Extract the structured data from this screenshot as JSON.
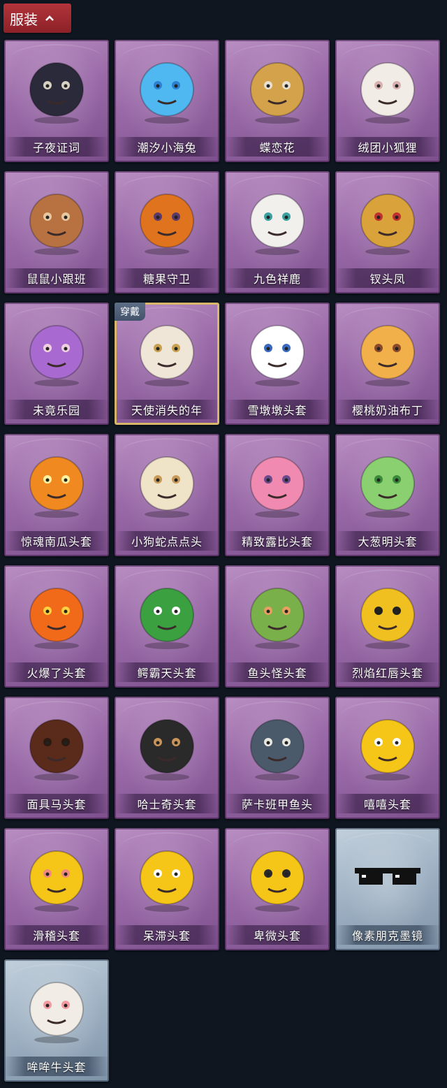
{
  "category": {
    "label": "服装"
  },
  "equipped_badge": "穿戴",
  "items": [
    {
      "name": "子夜证词",
      "icon": "owl-costume-icon",
      "tint": "purple"
    },
    {
      "name": "潮汐小海兔",
      "icon": "blue-sea-bunny-icon",
      "tint": "purple"
    },
    {
      "name": "蝶恋花",
      "icon": "bell-wreath-icon",
      "tint": "purple"
    },
    {
      "name": "绒团小狐狸",
      "icon": "white-fox-icon",
      "tint": "purple"
    },
    {
      "name": "鼠鼠小跟班",
      "icon": "hamster-icon",
      "tint": "purple"
    },
    {
      "name": "糖果守卫",
      "icon": "pumpkin-scarecrow-icon",
      "tint": "purple"
    },
    {
      "name": "九色祥鹿",
      "icon": "deer-icon",
      "tint": "purple"
    },
    {
      "name": "钗头凤",
      "icon": "phoenix-crown-doll-icon",
      "tint": "purple"
    },
    {
      "name": "未竟乐园",
      "icon": "purple-hair-doll-icon",
      "tint": "purple"
    },
    {
      "name": "天使消失的年",
      "icon": "angel-doll-icon",
      "tint": "purple",
      "equipped": true
    },
    {
      "name": "雪墩墩头套",
      "icon": "snowman-head-icon",
      "tint": "purple"
    },
    {
      "name": "樱桃奶油布丁",
      "icon": "pudding-head-icon",
      "tint": "purple"
    },
    {
      "name": "惊魂南瓜头套",
      "icon": "pumpkin-head-icon",
      "tint": "purple"
    },
    {
      "name": "小狗蛇点点头",
      "icon": "snake-head-icon",
      "tint": "purple"
    },
    {
      "name": "精致露比头套",
      "icon": "pink-beaver-head-icon",
      "tint": "purple"
    },
    {
      "name": "大葱明头套",
      "icon": "scallion-head-icon",
      "tint": "purple"
    },
    {
      "name": "火爆了头套",
      "icon": "fire-head-icon",
      "tint": "purple"
    },
    {
      "name": "鳄霸天头套",
      "icon": "crocodile-head-icon",
      "tint": "purple"
    },
    {
      "name": "鱼头怪头套",
      "icon": "fish-head-icon",
      "tint": "purple"
    },
    {
      "name": "烈焰红唇头套",
      "icon": "yellow-mask-head-icon",
      "tint": "purple"
    },
    {
      "name": "面具马头套",
      "icon": "horse-head-icon",
      "tint": "purple"
    },
    {
      "name": "哈士奇头套",
      "icon": "dog-head-icon",
      "tint": "purple"
    },
    {
      "name": "萨卡班甲鱼头",
      "icon": "fish-blob-head-icon",
      "tint": "purple"
    },
    {
      "name": "嘻嘻头套",
      "icon": "grin-emoji-head-icon",
      "tint": "purple"
    },
    {
      "name": "滑稽头套",
      "icon": "smirk-emoji-head-icon",
      "tint": "purple"
    },
    {
      "name": "呆滞头套",
      "icon": "stare-emoji-head-icon",
      "tint": "purple"
    },
    {
      "name": "卑微头套",
      "icon": "shy-emoji-head-icon",
      "tint": "purple"
    },
    {
      "name": "像素朋克墨镜",
      "icon": "pixel-sunglasses-icon",
      "tint": "blue"
    },
    {
      "name": "哞哞牛头套",
      "icon": "cow-head-icon",
      "tint": "blue"
    }
  ]
}
